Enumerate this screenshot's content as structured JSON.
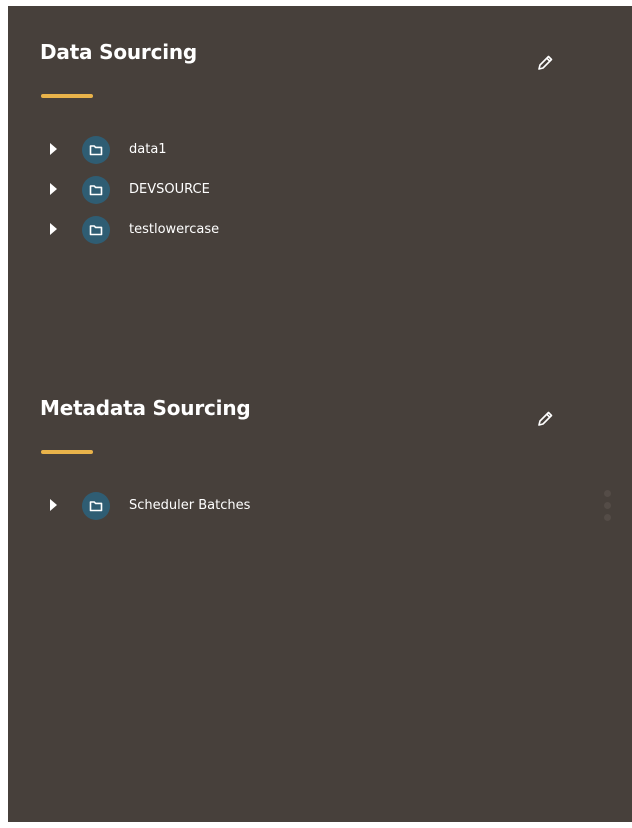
{
  "data_sourcing": {
    "title": "Data Sourcing",
    "edit_icon": "pencil-icon",
    "items": [
      {
        "label": "data1",
        "icon": "folder-icon",
        "expand_icon": "caret-right-icon"
      },
      {
        "label": "DEVSOURCE",
        "icon": "folder-icon",
        "expand_icon": "caret-right-icon"
      },
      {
        "label": "testlowercase",
        "icon": "folder-icon",
        "expand_icon": "caret-right-icon"
      }
    ]
  },
  "metadata_sourcing": {
    "title": "Metadata Sourcing",
    "edit_icon": "pencil-icon",
    "items": [
      {
        "label": "Scheduler Batches",
        "icon": "folder-icon",
        "expand_icon": "caret-right-icon"
      }
    ]
  },
  "colors": {
    "panel_background": "#47403b",
    "accent": "#e9b34a",
    "folder_badge": "#2f5d73",
    "text": "#ffffff"
  }
}
